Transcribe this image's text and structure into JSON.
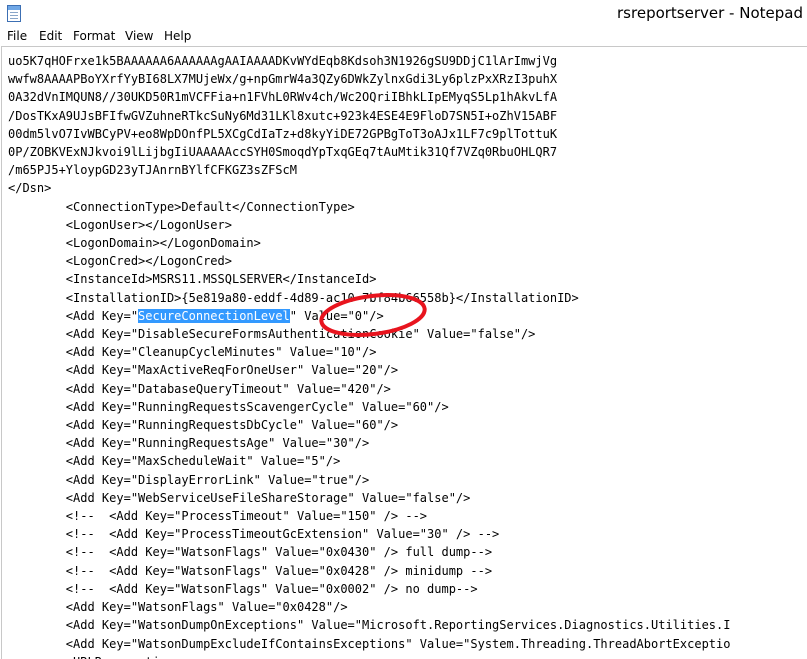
{
  "window": {
    "title": "rsreportserver - Notepad",
    "icon": "notepad-icon"
  },
  "menu": {
    "file": "File",
    "edit": "Edit",
    "format": "Format",
    "view": "View",
    "help": "Help"
  },
  "editor": {
    "lines": [
      "uo5K7qHOFrxe1k5BAAAAAA6AAAAAAgAAIAAAADKvWYdEqb8Kdsoh3N1926gSU9DDjC1lArImwjVg",
      "wwfw8AAAAPBoYXrfYyBI68LX7MUjeWx/g+npGmrW4a3QZy6DWkZylnxGdi3Ly6plzPxXRzI3puhX",
      "0A32dVnIMQUN8//30UKD50R1mVCFFia+n1FVhL0RWv4ch/Wc2OQriIBhkLIpEMyqS5Lp1hAkvLfA",
      "/DosTKxA9UJsBFIfwGVZuhneRTkcSuNy6Md31LKl8xutc+923k4ESE4E9FloD7SN5I+oZhV15ABF",
      "00dm5lvO7IvWBCyPV+eo8WpDOnfPL5XCgCdIaTz+d8kyYiDE72GPBgToT3oAJx1LF7c9plTottuK",
      "0P/ZOBKVExNJkvoi9lLijbgIiUAAAAAccSYH0SmoqdYpTxqGEq7tAuMtik31Qf7VZq0RbuOHLQR7",
      "/m65PJ5+YloypGD23yTJAnrnBYlfCFKGZ3sZFScM",
      "</Dsn>",
      "        <ConnectionType>Default</ConnectionType>",
      "        <LogonUser></LogonUser>",
      "        <LogonDomain></LogonDomain>",
      "        <LogonCred></LogonCred>",
      "        <InstanceId>MSRS11.MSSQLSERVER</InstanceId>",
      "        <InstallationID>{5e819a80-eddf-4d89-ac10-7bf84b66558b}</InstallationID>",
      "        <Add Key=\"SecureConnectionLevel\" Value=\"0\"/>",
      "        <Add Key=\"DisableSecureFormsAuthenticationCookie\" Value=\"false\"/>",
      "        <Add Key=\"CleanupCycleMinutes\" Value=\"10\"/>",
      "        <Add Key=\"MaxActiveReqForOneUser\" Value=\"20\"/>",
      "        <Add Key=\"DatabaseQueryTimeout\" Value=\"420\"/>",
      "        <Add Key=\"RunningRequestsScavengerCycle\" Value=\"60\"/>",
      "        <Add Key=\"RunningRequestsDbCycle\" Value=\"60\"/>",
      "        <Add Key=\"RunningRequestsAge\" Value=\"30\"/>",
      "        <Add Key=\"MaxScheduleWait\" Value=\"5\"/>",
      "        <Add Key=\"DisplayErrorLink\" Value=\"true\"/>",
      "        <Add Key=\"WebServiceUseFileShareStorage\" Value=\"false\"/>",
      "        <!--  <Add Key=\"ProcessTimeout\" Value=\"150\" /> -->",
      "        <!--  <Add Key=\"ProcessTimeoutGcExtension\" Value=\"30\" /> -->",
      "        <!--  <Add Key=\"WatsonFlags\" Value=\"0x0430\" /> full dump-->",
      "        <!--  <Add Key=\"WatsonFlags\" Value=\"0x0428\" /> minidump -->",
      "        <!--  <Add Key=\"WatsonFlags\" Value=\"0x0002\" /> no dump-->",
      "        <Add Key=\"WatsonFlags\" Value=\"0x0428\"/>",
      "        <Add Key=\"WatsonDumpOnExceptions\" Value=\"Microsoft.ReportingServices.Diagnostics.Utilities.I",
      "        <Add Key=\"WatsonDumpExcludeIfContainsExceptions\" Value=\"System.Threading.ThreadAbortExceptio",
      "        <URLReservations>"
    ],
    "selection": {
      "line_index": 14,
      "text": "SecureConnectionLevel"
    }
  },
  "annotation": {
    "shape": "ellipse",
    "color": "#e8141e",
    "label": "highlight-circle"
  }
}
